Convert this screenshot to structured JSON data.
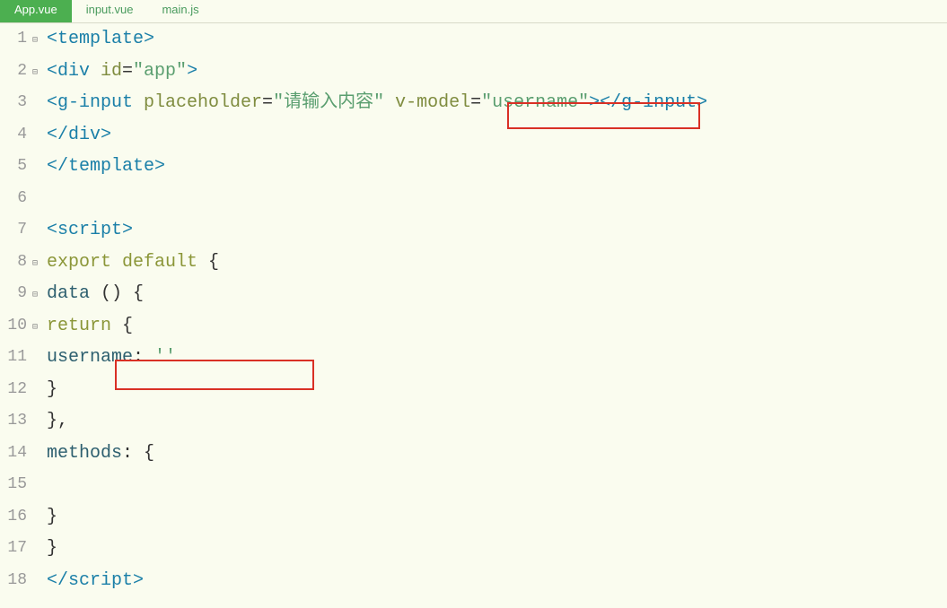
{
  "tabs": [
    {
      "label": "App.vue",
      "active": true
    },
    {
      "label": "input.vue",
      "active": false
    },
    {
      "label": "main.js",
      "active": false
    }
  ],
  "lines": {
    "l1": {
      "ln": "1",
      "fold": "⊟"
    },
    "l2": {
      "ln": "2",
      "fold": "⊟"
    },
    "l3": {
      "ln": "3",
      "fold": ""
    },
    "l4": {
      "ln": "4",
      "fold": ""
    },
    "l5": {
      "ln": "5",
      "fold": ""
    },
    "l6": {
      "ln": "6",
      "fold": ""
    },
    "l7": {
      "ln": "7",
      "fold": ""
    },
    "l8": {
      "ln": "8",
      "fold": "⊟"
    },
    "l9": {
      "ln": "9",
      "fold": "⊟"
    },
    "l10": {
      "ln": "10",
      "fold": "⊟"
    },
    "l11": {
      "ln": "11",
      "fold": ""
    },
    "l12": {
      "ln": "12",
      "fold": ""
    },
    "l13": {
      "ln": "13",
      "fold": ""
    },
    "l14": {
      "ln": "14",
      "fold": ""
    },
    "l15": {
      "ln": "15",
      "fold": ""
    },
    "l16": {
      "ln": "16",
      "fold": ""
    },
    "l17": {
      "ln": "17",
      "fold": ""
    },
    "l18": {
      "ln": "18",
      "fold": ""
    }
  },
  "code": {
    "template_open": "<template>",
    "div_open_1": "<div",
    "div_attr_id": " id",
    "eq": "=",
    "app_val": "\"app\"",
    "gt": ">",
    "ginput_open": "<g-input",
    "placeholder_attr": " placeholder",
    "placeholder_val": "\"请输入内容\"",
    "vmodel_attr": " v-model",
    "vmodel_val": "\"username\"",
    "ginput_close": "</g-input>",
    "div_close": "</div>",
    "template_close": "</template>",
    "script_open": "<script>",
    "export": "export",
    "default": " default",
    "brace_open": " {",
    "data_name": "data",
    "data_parens": " ()",
    "brace_open2": " {",
    "return": "return",
    "brace_open3": " {",
    "username_key": "username",
    "colon": ":",
    "empty_str": " ''",
    "brace_close": "}",
    "comma": ",",
    "methods_name": "methods",
    "colon2": ":",
    "brace_open4": " {",
    "script_close": "</scr"
  },
  "script_close_suffix": "ipt>"
}
